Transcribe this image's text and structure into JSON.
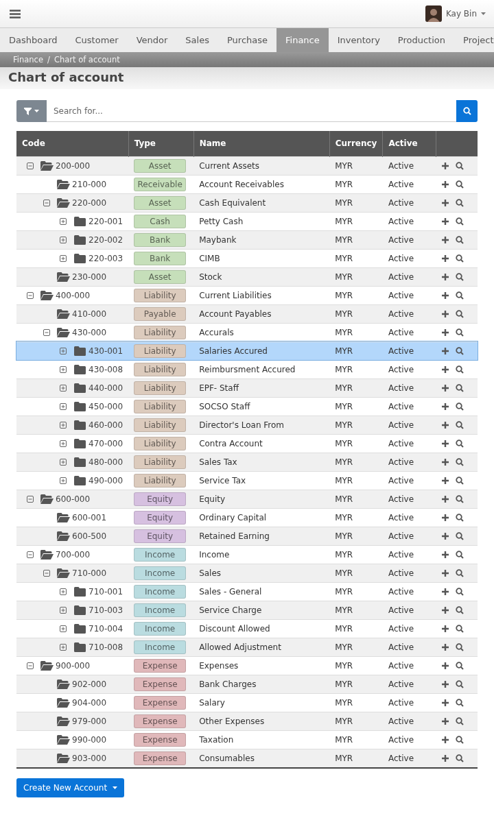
{
  "topbar": {
    "user_name": "Kay Bin"
  },
  "nav_tabs": [
    {
      "label": "Dashboard",
      "selected": false
    },
    {
      "label": "Customer",
      "selected": false
    },
    {
      "label": "Vendor",
      "selected": false
    },
    {
      "label": "Sales",
      "selected": false
    },
    {
      "label": "Purchase",
      "selected": false
    },
    {
      "label": "Finance",
      "selected": true
    },
    {
      "label": "Inventory",
      "selected": false
    },
    {
      "label": "Production",
      "selected": false
    },
    {
      "label": "Project",
      "selected": false
    }
  ],
  "breadcrumb": {
    "items": [
      "Finance",
      "Chart of account"
    ],
    "separator": "/"
  },
  "page_title": "Chart of account",
  "search": {
    "placeholder": "Search for..."
  },
  "table": {
    "columns": [
      "Code",
      "Type",
      "Name",
      "Currency",
      "Active"
    ],
    "rows": [
      {
        "code": "200-000",
        "type": "Asset",
        "color": "#c6dfba",
        "name": "Current Assets",
        "currency": "MYR",
        "active": "Active",
        "expanded": true,
        "selected": false,
        "children": [
          {
            "code": "210-000",
            "type": "Receivable",
            "color": "#c6dfba",
            "name": "Account Receivables",
            "currency": "MYR",
            "active": "Active",
            "selected": false
          },
          {
            "code": "220-000",
            "type": "Asset",
            "color": "#c6dfba",
            "name": "Cash Equivalent",
            "currency": "MYR",
            "active": "Active",
            "expanded": true,
            "selected": false,
            "children": [
              {
                "code": "220-001",
                "type": "Cash",
                "color": "#c6dfba",
                "name": "Petty Cash",
                "currency": "MYR",
                "active": "Active",
                "expanded": false,
                "selected": false
              },
              {
                "code": "220-002",
                "type": "Bank",
                "color": "#c6dfba",
                "name": "Maybank",
                "currency": "MYR",
                "active": "Active",
                "expanded": false,
                "selected": false
              },
              {
                "code": "220-003",
                "type": "Bank",
                "color": "#c6dfba",
                "name": "CIMB",
                "currency": "MYR",
                "active": "Active",
                "expanded": false,
                "selected": false
              }
            ]
          },
          {
            "code": "230-000",
            "type": "Asset",
            "color": "#c6dfba",
            "name": "Stock",
            "currency": "MYR",
            "active": "Active",
            "selected": false
          }
        ]
      },
      {
        "code": "400-000",
        "type": "Liability",
        "color": "#dccbbd",
        "name": "Current Liabilities",
        "currency": "MYR",
        "active": "Active",
        "expanded": true,
        "selected": false,
        "children": [
          {
            "code": "410-000",
            "type": "Payable",
            "color": "#dccbbd",
            "name": "Account Payables",
            "currency": "MYR",
            "active": "Active",
            "selected": false
          },
          {
            "code": "430-000",
            "type": "Liability",
            "color": "#dccbbd",
            "name": "Accurals",
            "currency": "MYR",
            "active": "Active",
            "expanded": true,
            "selected": false,
            "children": [
              {
                "code": "430-001",
                "type": "Liability",
                "color": "#dccbbd",
                "name": "Salaries Accured",
                "currency": "MYR",
                "active": "Active",
                "expanded": false,
                "selected": true
              },
              {
                "code": "430-008",
                "type": "Liability",
                "color": "#dccbbd",
                "name": "Reimbursment Accured",
                "currency": "MYR",
                "active": "Active",
                "expanded": false,
                "selected": false
              },
              {
                "code": "440-000",
                "type": "Liability",
                "color": "#dccbbd",
                "name": "EPF- Staff",
                "currency": "MYR",
                "active": "Active",
                "expanded": false,
                "selected": false
              },
              {
                "code": "450-000",
                "type": "Liability",
                "color": "#dccbbd",
                "name": "SOCSO Staff",
                "currency": "MYR",
                "active": "Active",
                "expanded": false,
                "selected": false
              },
              {
                "code": "460-000",
                "type": "Liability",
                "color": "#dccbbd",
                "name": "Director's Loan From",
                "currency": "MYR",
                "active": "Active",
                "expanded": false,
                "selected": false
              },
              {
                "code": "470-000",
                "type": "Liability",
                "color": "#dccbbd",
                "name": "Contra Account",
                "currency": "MYR",
                "active": "Active",
                "expanded": false,
                "selected": false
              },
              {
                "code": "480-000",
                "type": "Liability",
                "color": "#dccbbd",
                "name": "Sales Tax",
                "currency": "MYR",
                "active": "Active",
                "expanded": false,
                "selected": false
              },
              {
                "code": "490-000",
                "type": "Liability",
                "color": "#dccbbd",
                "name": "Service Tax",
                "currency": "MYR",
                "active": "Active",
                "expanded": false,
                "selected": false
              }
            ]
          }
        ]
      },
      {
        "code": "600-000",
        "type": "Equity",
        "color": "#d6c0e0",
        "name": "Equity",
        "currency": "MYR",
        "active": "Active",
        "expanded": true,
        "selected": false,
        "children": [
          {
            "code": "600-001",
            "type": "Equity",
            "color": "#d6c0e0",
            "name": "Ordinary Capital",
            "currency": "MYR",
            "active": "Active",
            "selected": false
          },
          {
            "code": "600-500",
            "type": "Equity",
            "color": "#d6c0e0",
            "name": "Retained Earning",
            "currency": "MYR",
            "active": "Active",
            "selected": false
          }
        ]
      },
      {
        "code": "700-000",
        "type": "Income",
        "color": "#badce0",
        "name": "Income",
        "currency": "MYR",
        "active": "Active",
        "expanded": true,
        "selected": false,
        "children": [
          {
            "code": "710-000",
            "type": "Income",
            "color": "#badce0",
            "name": "Sales",
            "currency": "MYR",
            "active": "Active",
            "expanded": true,
            "selected": false,
            "children": [
              {
                "code": "710-001",
                "type": "Income",
                "color": "#badce0",
                "name": "Sales - General",
                "currency": "MYR",
                "active": "Active",
                "expanded": false,
                "selected": false
              },
              {
                "code": "710-003",
                "type": "Income",
                "color": "#badce0",
                "name": "Service Charge",
                "currency": "MYR",
                "active": "Active",
                "expanded": false,
                "selected": false
              },
              {
                "code": "710-004",
                "type": "Income",
                "color": "#badce0",
                "name": "Discount Allowed",
                "currency": "MYR",
                "active": "Active",
                "expanded": false,
                "selected": false
              },
              {
                "code": "710-008",
                "type": "Income",
                "color": "#badce0",
                "name": "Allowed Adjustment",
                "currency": "MYR",
                "active": "Active",
                "expanded": false,
                "selected": false
              }
            ]
          }
        ]
      },
      {
        "code": "900-000",
        "type": "Expense",
        "color": "#e0b8ba",
        "name": "Expenses",
        "currency": "MYR",
        "active": "Active",
        "expanded": true,
        "selected": false,
        "children": [
          {
            "code": "902-000",
            "type": "Expense",
            "color": "#e0b8ba",
            "name": "Bank Charges",
            "currency": "MYR",
            "active": "Active",
            "selected": false
          },
          {
            "code": "904-000",
            "type": "Expense",
            "color": "#e0b8ba",
            "name": "Salary",
            "currency": "MYR",
            "active": "Active",
            "selected": false
          },
          {
            "code": "979-000",
            "type": "Expense",
            "color": "#e0b8ba",
            "name": "Other Expenses",
            "currency": "MYR",
            "active": "Active",
            "selected": false
          },
          {
            "code": "990-000",
            "type": "Expense",
            "color": "#e0b8ba",
            "name": "Taxation",
            "currency": "MYR",
            "active": "Active",
            "selected": false
          },
          {
            "code": "903-000",
            "type": "Expense",
            "color": "#e0b8ba",
            "name": "Consumables",
            "currency": "MYR",
            "active": "Active",
            "selected": false
          }
        ]
      }
    ]
  },
  "create_button": {
    "label": "Create New Account"
  }
}
